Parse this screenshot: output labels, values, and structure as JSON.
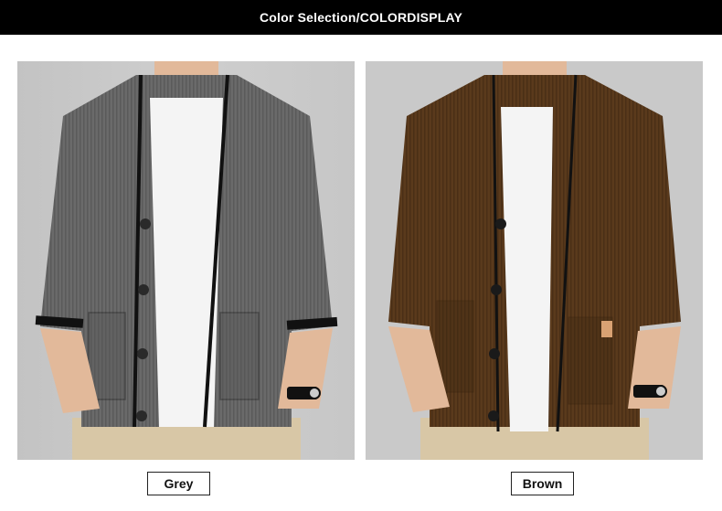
{
  "header": {
    "title": "Color Selection/COLORDISPLAY"
  },
  "products": [
    {
      "label": "Grey",
      "sweater_color": "#6a6a6a",
      "sweater_dark": "#4a4a4a",
      "trim_color": "#111111"
    },
    {
      "label": "Brown",
      "sweater_color": "#5a3a1c",
      "sweater_dark": "#3e2711",
      "trim_color": "#111111"
    }
  ],
  "colors": {
    "background": "#ffffff",
    "banner": "#000000",
    "photo_bg": "#c9c9c9",
    "shirt": "#f4f4f4",
    "skin": "#e2b99a",
    "pants": "#d8c7a6"
  }
}
